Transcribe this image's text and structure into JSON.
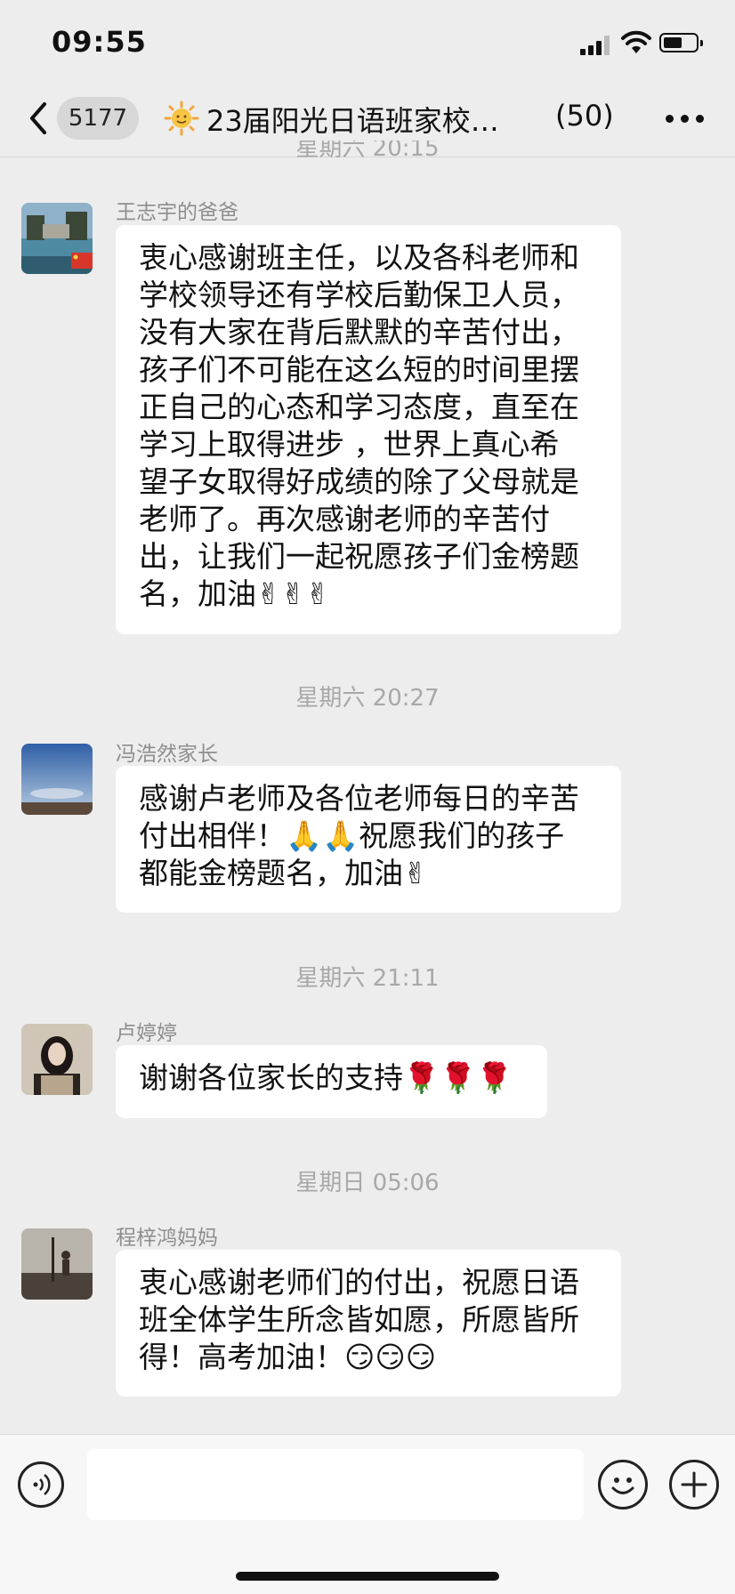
{
  "status_bar": {
    "time": "09:55"
  },
  "nav": {
    "unread_count": "5177",
    "group_name": "23届阳光日语班家校…",
    "member_count": "(50)"
  },
  "messages": [
    {
      "timestamp_partial": "星期六 20:15",
      "sender": "王志宇的爸爸",
      "avatar": "pool-photo-avatar",
      "text": "衷心感谢班主任，以及各科老师和\n学校领导还有学校后勤保卫人员，\n没有大家在背后默默的辛苦付出，\n孩子们不可能在这么短的时间里摆\n正自己的心态和学习态度，直至在\n学习上取得进步 ，世界上真心希\n望子女取得好成绩的除了父母就是\n老师了。再次感谢老师的辛苦付\n出，让我们一起祝愿孩子们金榜题\n名，加油✌✌✌"
    },
    {
      "timestamp": "星期六 20:27",
      "sender": "冯浩然家长",
      "avatar": "sky-photo-avatar",
      "text": "感谢卢老师及各位老师每日的辛苦\n付出相伴！🙏🙏祝愿我们的孩子\n都能金榜题名，加油✌"
    },
    {
      "timestamp": "星期六 21:11",
      "sender": "卢婷婷",
      "avatar": "portrait-avatar",
      "text": "谢谢各位家长的支持🌹🌹🌹"
    },
    {
      "timestamp": "星期日 05:06",
      "sender": "程梓鸿妈妈",
      "avatar": "outdoor-photo-avatar",
      "text": "衷心感谢老师们的付出，祝愿日语\n班全体学生所念皆如愿，所愿皆所\n得！高考加油！😏😏😏"
    }
  ],
  "input": {
    "placeholder": ""
  }
}
